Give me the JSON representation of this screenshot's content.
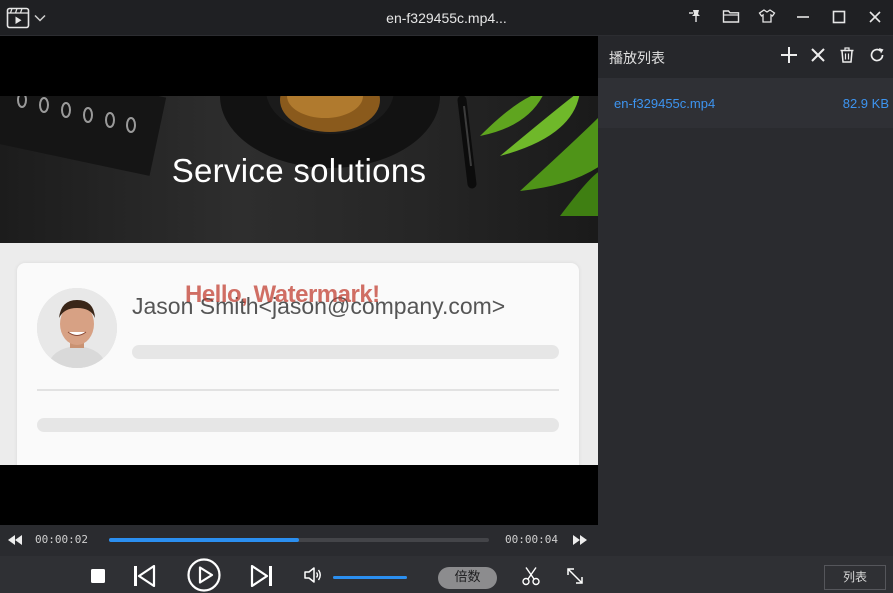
{
  "window": {
    "title": "en-f329455c.mp4..."
  },
  "icons": {
    "app_menu": "film-icon",
    "app_menu_arrow": "chevron-down-icon",
    "pin": "pin-icon",
    "open_folder": "folder-icon",
    "skin": "shirt-icon",
    "minimize": "minimize-icon",
    "maximize": "maximize-icon",
    "close": "close-icon"
  },
  "video": {
    "banner_title": "Service solutions",
    "contact_text": "Jason Smith<jason@company.com>",
    "watermark_text": "Hello, Watermark!"
  },
  "progress": {
    "current_time": "00:00:02",
    "total_time": "00:00:04",
    "played_fraction": 0.5
  },
  "controls": {
    "volume_fraction": 1.0,
    "speed_label": "倍数",
    "playlist_toggle_label": "列表"
  },
  "playlist": {
    "title": "播放列表",
    "items": [
      {
        "name": "en-f329455c.mp4",
        "size": "82.9 KB"
      }
    ]
  },
  "colors": {
    "accent": "#2b8ff0",
    "playlist_link": "#3d94f0",
    "watermark": "#c0392b",
    "background": "#1e1f22"
  }
}
